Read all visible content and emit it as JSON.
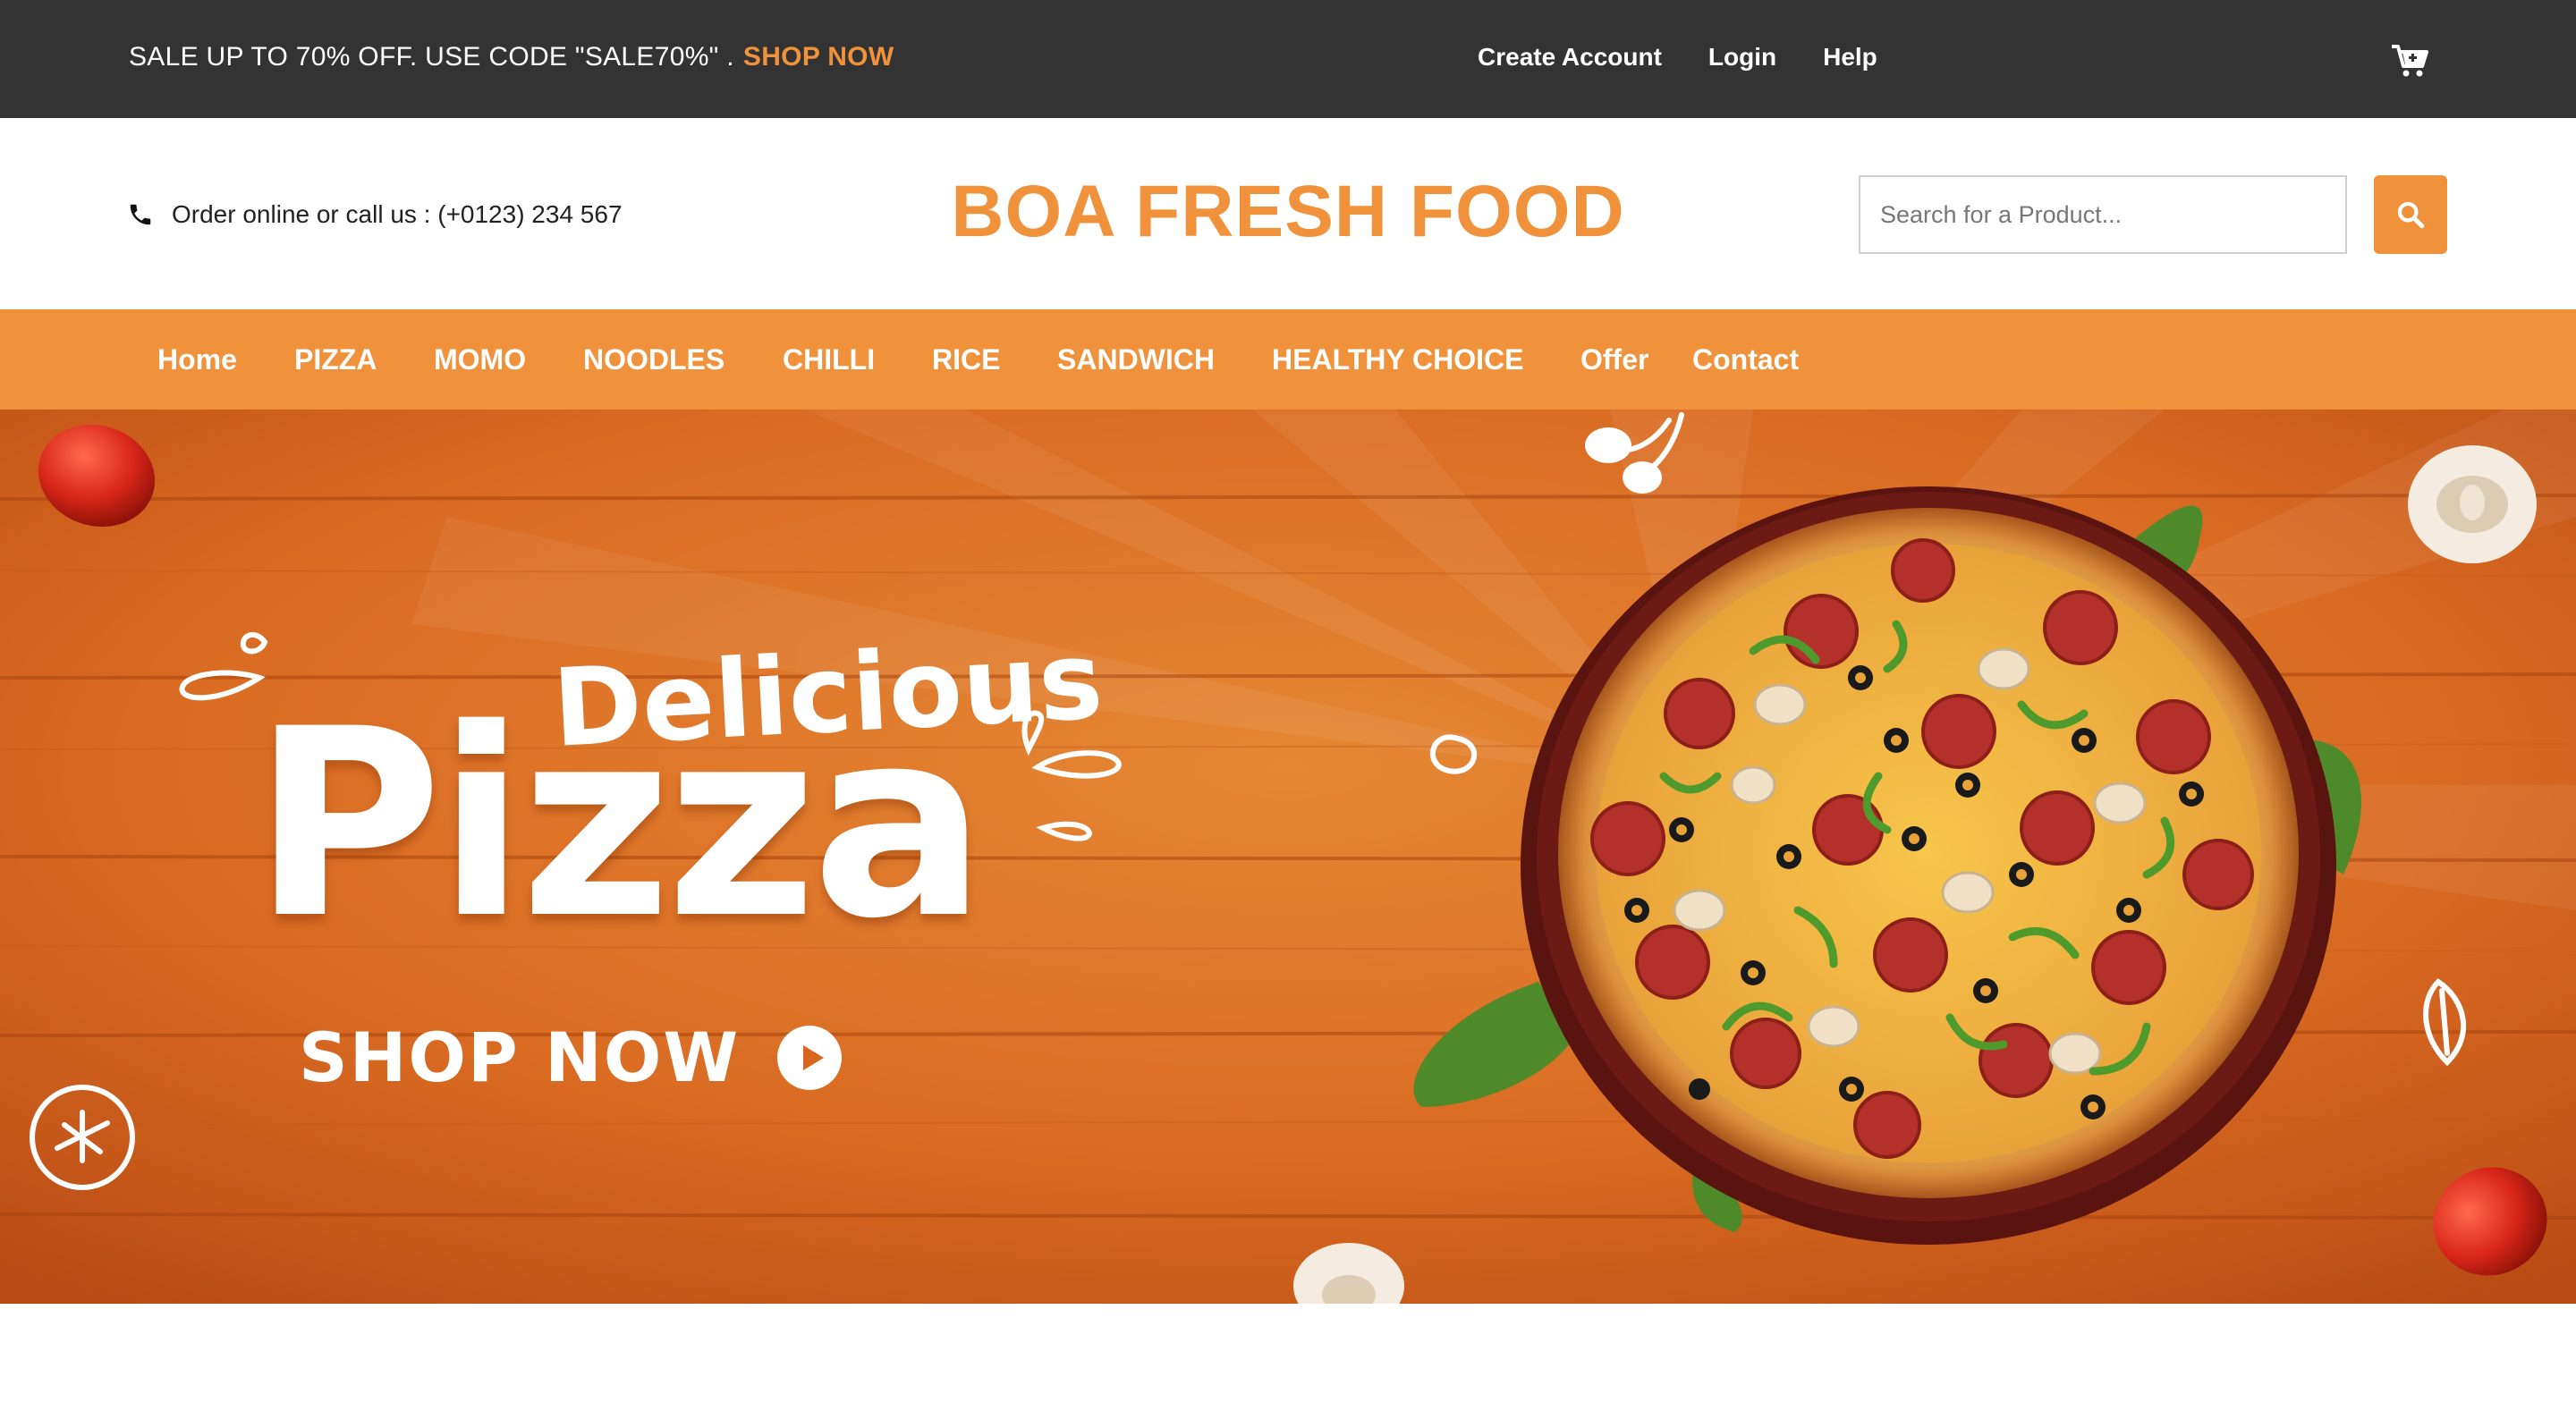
{
  "promo": {
    "text": "SALE UP TO 70% OFF. USE CODE \"SALE70%\" .",
    "link": "SHOP NOW"
  },
  "top_links": {
    "create_account": "Create Account",
    "login": "Login",
    "help": "Help"
  },
  "icons": {
    "cart": "cart-icon",
    "phone": "phone-icon",
    "search": "search-icon",
    "play": "play-circle-icon"
  },
  "header": {
    "contact_text": "Order online or call us : (+0123) 234 567",
    "brand": "BOA FRESH FOOD",
    "search_placeholder": "Search for a Product..."
  },
  "nav": {
    "items": [
      "Home",
      "PIZZA",
      "MOMO",
      "NOODLES",
      "CHILLI",
      "RICE",
      "SANDWICH",
      "HEALTHY CHOICE",
      "Offer",
      "Contact"
    ]
  },
  "hero": {
    "line1": "Delicious",
    "line2": "Pizza",
    "cta": "SHOP NOW"
  },
  "colors": {
    "accent": "#f0923b",
    "topbar": "#333333",
    "hero_bg": "#d9661f"
  }
}
